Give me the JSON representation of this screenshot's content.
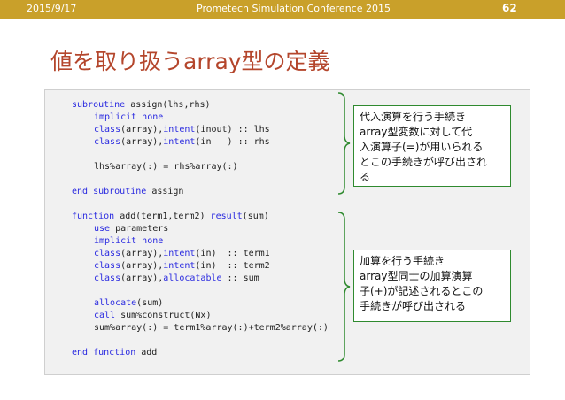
{
  "header": {
    "date": "2015/9/17",
    "conference": "Prometech Simulation Conference 2015",
    "page_number": "62"
  },
  "title": "値を取り扱うarray型の定義",
  "code": {
    "l01a": "subroutine",
    "l01b": " assign(lhs,rhs)",
    "l02a": "implicit none",
    "l03a": "class",
    "l03b": "(array),",
    "l03c": "intent",
    "l03d": "(inout) :: lhs",
    "l04a": "class",
    "l04b": "(array),",
    "l04c": "intent",
    "l04d": "(in   ) :: rhs",
    "l06": "lhs%array(:) = rhs%array(:)",
    "l08a": "end subroutine",
    "l08b": " assign",
    "l10a": "function",
    "l10b": " add(term1,term2) ",
    "l10c": "result",
    "l10d": "(sum)",
    "l11a": "use",
    "l11b": " parameters",
    "l12a": "implicit none",
    "l13a": "class",
    "l13b": "(array),",
    "l13c": "intent",
    "l13d": "(in)  :: term1",
    "l14a": "class",
    "l14b": "(array),",
    "l14c": "intent",
    "l14d": "(in)  :: term2",
    "l15a": "class",
    "l15b": "(array),",
    "l15c": "allocatable",
    "l15d": " :: sum",
    "l17a": "allocate",
    "l17b": "(sum)",
    "l18a": "call",
    "l18b": " sum%construct(Nx)",
    "l19": "sum%array(:) = term1%array(:)+term2%array(:)",
    "l21a": "end function",
    "l21b": " add"
  },
  "note1": {
    "lines": [
      "代入演算を行う手続き",
      "array型変数に対して代",
      "入演算子(=)が用いられる",
      "とこの手続きが呼び出され",
      "る"
    ]
  },
  "note2": {
    "lines": [
      "加算を行う手続き",
      "array型同士の加算演算",
      "子(+)が記述されるとこの",
      "手続きが呼び出される"
    ]
  },
  "colors": {
    "header_bar": "#c9a02a",
    "title": "#b4462c",
    "keyword": "#2a2ae0",
    "brace": "#2f8a2f"
  }
}
